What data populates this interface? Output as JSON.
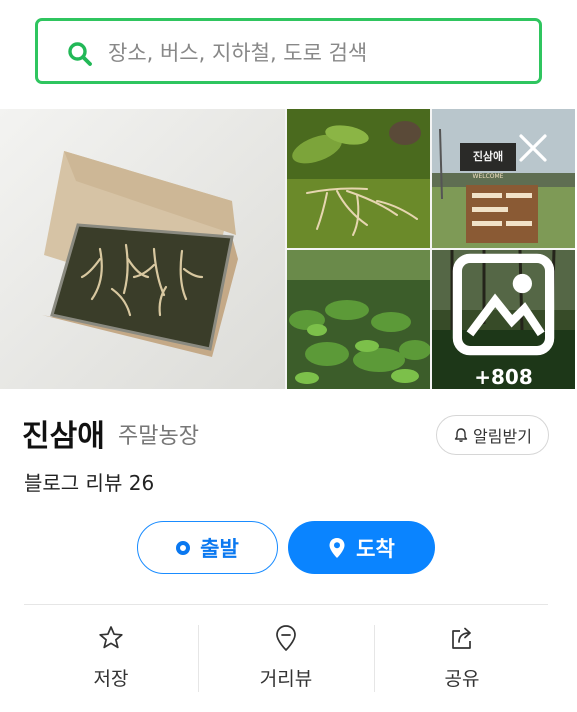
{
  "search": {
    "placeholder": "장소, 버스, 지하철, 도로 검색"
  },
  "photos": {
    "sign_title": "진삼애",
    "sign_sub": "WELCOME",
    "more_count": "+808"
  },
  "place": {
    "name": "진삼애",
    "category": "주말농장",
    "alert_label": "알림받기",
    "review_text": "블로그 리뷰 26"
  },
  "route": {
    "start_label": "출발",
    "end_label": "도착"
  },
  "actions": [
    {
      "label": "저장",
      "icon": "star-icon"
    },
    {
      "label": "거리뷰",
      "icon": "street-view-pin-icon"
    },
    {
      "label": "공유",
      "icon": "share-icon"
    }
  ],
  "colors": {
    "search_border": "#2fc55f",
    "primary_blue": "#0a84ff"
  }
}
